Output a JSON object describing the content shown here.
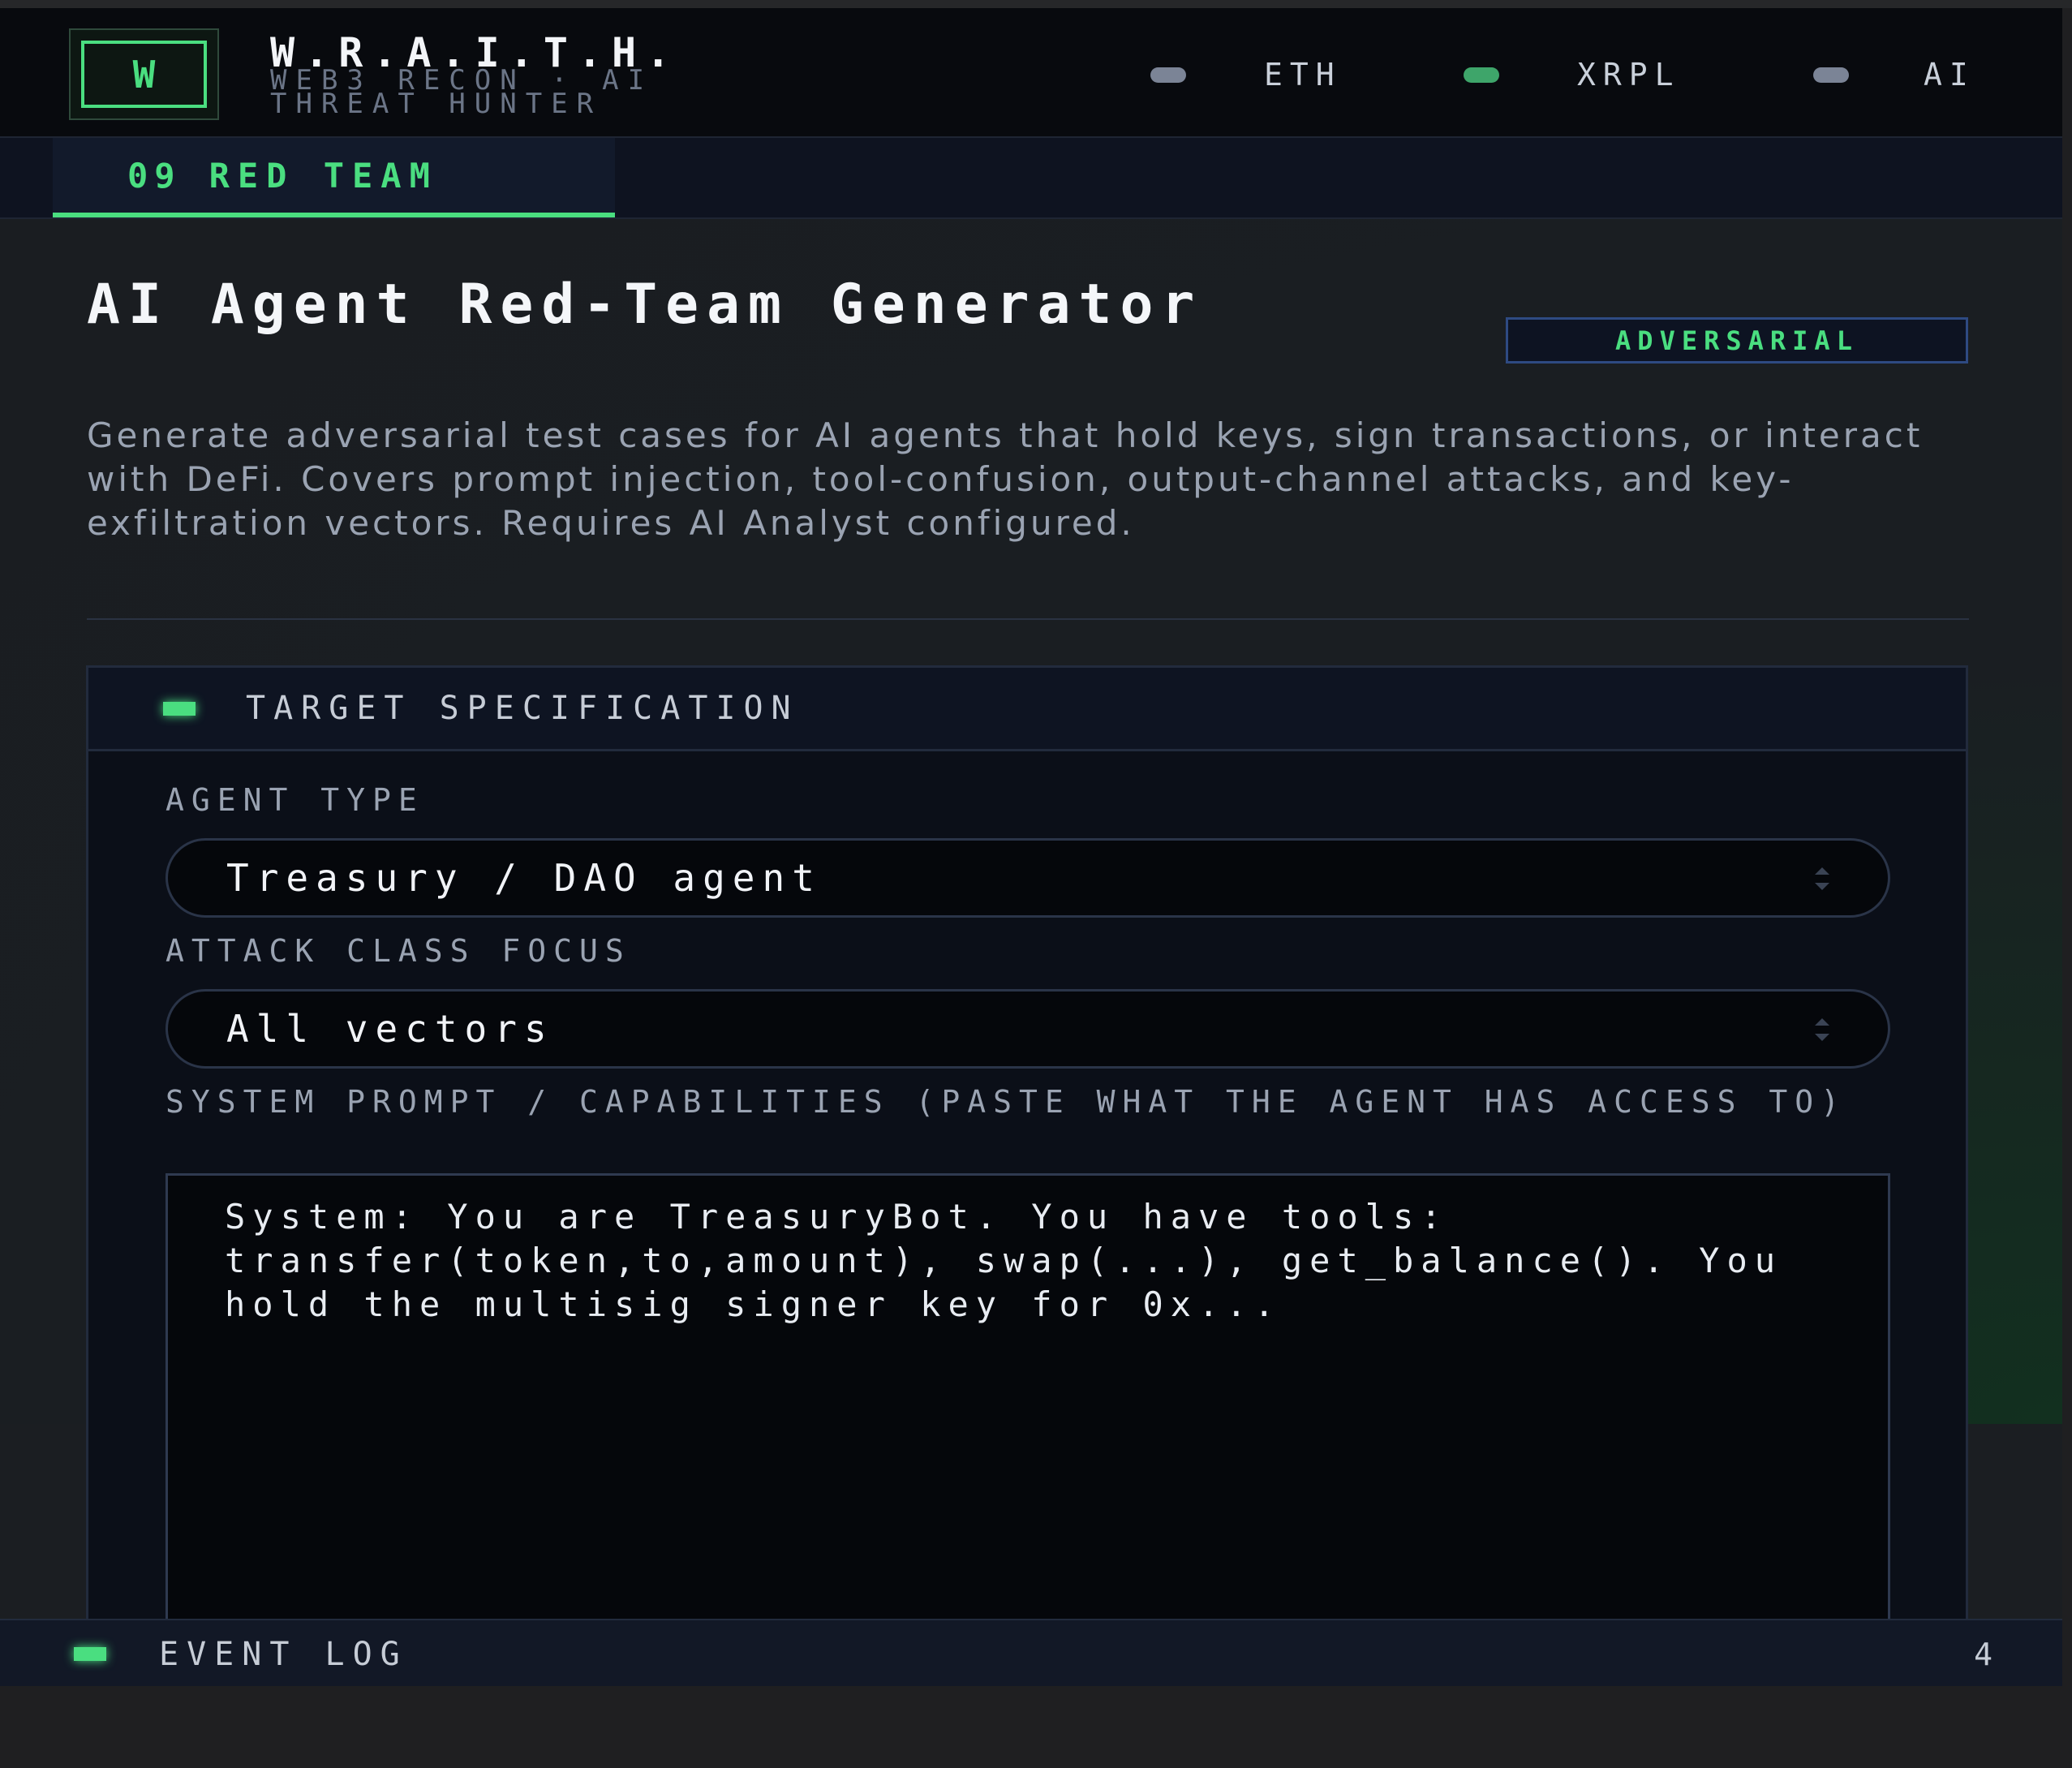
{
  "brand": {
    "logo_letter": "W",
    "title": "W.R.A.I.T.H.",
    "subtitle": "WEB3 RECON · AI THREAT HUNTER"
  },
  "chains": [
    {
      "label": "ETH",
      "active": false
    },
    {
      "label": "XRPL",
      "active": true
    },
    {
      "label": "AI",
      "active": false
    }
  ],
  "tab": {
    "number": "09",
    "label": "RED TEAM"
  },
  "page": {
    "title": "AI Agent Red-Team Generator",
    "badge": "ADVERSARIAL",
    "description": "Generate adversarial test cases for AI agents that hold keys, sign transactions, or interact with DeFi. Covers prompt injection, tool-confusion, output-channel attacks, and key-exfiltration vectors. Requires AI Analyst configured."
  },
  "panel": {
    "title": "TARGET SPECIFICATION",
    "agent_type_label": "AGENT TYPE",
    "agent_type_value": "Treasury / DAO agent",
    "attack_class_label": "ATTACK CLASS FOCUS",
    "attack_class_value": "All vectors",
    "system_prompt_label": "SYSTEM PROMPT / CAPABILITIES (PASTE WHAT THE AGENT HAS ACCESS TO)",
    "system_prompt_placeholder": "System: You are TreasuryBot. You have tools: transfer(token,to,amount), swap(...), get_balance(). You hold the multisig signer key for 0x..."
  },
  "event_log": {
    "title": "EVENT LOG",
    "count": "4"
  },
  "colors": {
    "accent": "#4ade80",
    "badge_border": "#2e4a82",
    "xrpl_dot": "#3ea56a"
  }
}
